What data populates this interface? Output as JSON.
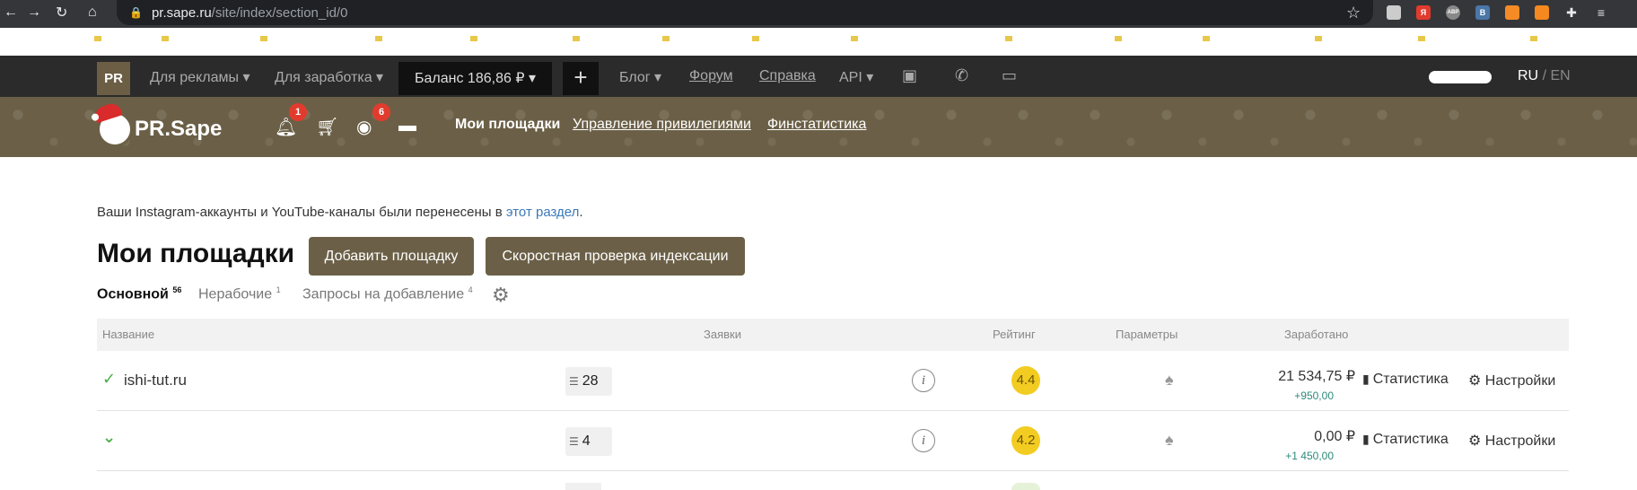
{
  "browser": {
    "url_host": "pr.sape.ru",
    "url_path": "/site/index/section_id/0",
    "extensions": [
      {
        "name": "site-icon",
        "label": "",
        "color": "#ccc"
      },
      {
        "name": "yandex-icon",
        "label": "Я",
        "color": "#e23b2d"
      },
      {
        "name": "abp-icon",
        "label": "ABP",
        "color": "#888"
      },
      {
        "name": "vk-icon",
        "label": "B",
        "color": "#4a76a8"
      },
      {
        "name": "rss-icon",
        "label": "",
        "color": "#f58b25"
      },
      {
        "name": "ok-icon",
        "label": "",
        "color": "#f5891f"
      },
      {
        "name": "puzzle-icon",
        "label": "",
        "color": "#35363a"
      },
      {
        "name": "playlist-icon",
        "label": "",
        "color": "#35363a"
      }
    ]
  },
  "topnav": {
    "badge": "PR",
    "for_ads": "Для рекламы",
    "for_earning": "Для заработка",
    "balance": "Баланс 186,86 ₽",
    "plus": "+",
    "blog": "Блог",
    "forum": "Форум",
    "help": "Справка",
    "api": "API",
    "lang_ru": "RU",
    "lang_sep": "/",
    "lang_en": "EN"
  },
  "brand": {
    "logo_text": "PR.Sape",
    "notifications_count": "1",
    "views_count": "6",
    "nav_my_sites": "Мои площадки",
    "nav_privileges": "Управление привилегиями",
    "nav_finstats": "Финстатистика"
  },
  "main": {
    "notice_text": "Ваши Instagram-аккаунты и YouTube-каналы были перенесены в ",
    "notice_link": "этот раздел",
    "notice_end": ".",
    "title": "Мои площадки",
    "add_site_button": "Добавить площадку",
    "speed_check_button": "Скоростная проверка индексации",
    "tabs": [
      {
        "label": "Основной",
        "count": "56"
      },
      {
        "label": "Нерабочие",
        "count": "1"
      },
      {
        "label": "Запросы на добавление",
        "count": "4"
      }
    ]
  },
  "table": {
    "headers": {
      "name": "Название",
      "requests": "Заявки",
      "rating": "Рейтинг",
      "params": "Параметры",
      "earned": "Заработано"
    },
    "rows": [
      {
        "name": "ishi-tut.ru",
        "requests": "28",
        "rating": "4.4",
        "earned": "21 534,75 ₽",
        "delta": "+950,00",
        "stats": "Статистика",
        "settings": "Настройки"
      },
      {
        "name": "",
        "requests": "4",
        "rating": "4.2",
        "earned": "0,00 ₽",
        "delta": "+1 450,00",
        "stats": "Статистика",
        "settings": "Настройки"
      }
    ]
  }
}
